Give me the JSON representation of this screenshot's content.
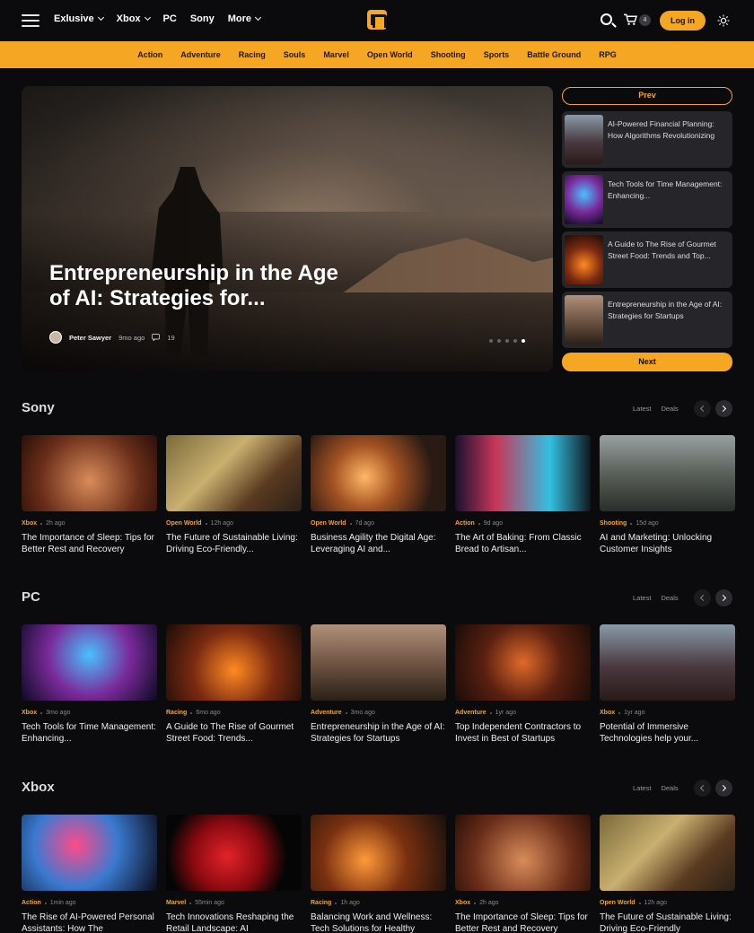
{
  "header": {
    "nav": [
      {
        "label": "Exlusive",
        "has_dropdown": true
      },
      {
        "label": "Xbox",
        "has_dropdown": true
      },
      {
        "label": "PC",
        "has_dropdown": false
      },
      {
        "label": "Sony",
        "has_dropdown": false
      },
      {
        "label": "More",
        "has_dropdown": true
      }
    ],
    "cart_count": "4",
    "login_label": "Log in"
  },
  "categories": [
    "Action",
    "Adventure",
    "Racing",
    "Souls",
    "Marvel",
    "Open World",
    "Shooting",
    "Sports",
    "Battle Ground",
    "RPG"
  ],
  "hero": {
    "title": "Entrepreneurship in the Age of AI: Strategies for...",
    "author": "Peter Sawyer",
    "time": "9mo ago",
    "comments": "19"
  },
  "side": {
    "prev_label": "Prev",
    "next_label": "Next",
    "items": [
      "AI-Powered Financial Planning: How Algorithms Revolutionizing",
      "Tech Tools for Time Management: Enhancing...",
      "A Guide to The Rise of Gourmet Street Food: Trends and Top...",
      "Entrepreneurship in the Age of AI: Strategies for Startups"
    ]
  },
  "sections": [
    {
      "title": "Sony",
      "tabs": [
        "Latest",
        "Deals"
      ],
      "cards": [
        {
          "category": "Xbox",
          "time": "2h ago",
          "title": "The Importance of Sleep: Tips for Better Rest and Recovery"
        },
        {
          "category": "Open World",
          "time": "12h ago",
          "title": "The Future of Sustainable Living: Driving Eco-Friendly..."
        },
        {
          "category": "Open World",
          "time": "7d ago",
          "title": "Business Agility the Digital Age: Leveraging AI and..."
        },
        {
          "category": "Action",
          "time": "9d ago",
          "title": "The Art of Baking: From Classic Bread to Artisan..."
        },
        {
          "category": "Shooting",
          "time": "15d ago",
          "title": "AI and Marketing: Unlocking Customer Insights"
        }
      ]
    },
    {
      "title": "PC",
      "tabs": [
        "Latest",
        "Deals"
      ],
      "cards": [
        {
          "category": "Xbox",
          "time": "3mo ago",
          "title": "Tech Tools for Time Management: Enhancing..."
        },
        {
          "category": "Racing",
          "time": "6mo ago",
          "title": "A Guide to The Rise of Gourmet Street Food: Trends..."
        },
        {
          "category": "Adventure",
          "time": "3mo ago",
          "title": "Entrepreneurship in the Age of AI: Strategies for Startups"
        },
        {
          "category": "Adventure",
          "time": "1yr ago",
          "title": "Top Independent Contractors to Invest in Best of Startups"
        },
        {
          "category": "Xbox",
          "time": "1yr ago",
          "title": "Potential of Immersive Technologies help your..."
        }
      ]
    },
    {
      "title": "Xbox",
      "tabs": [
        "Latest",
        "Deals"
      ],
      "cards": [
        {
          "category": "Action",
          "time": "1min ago",
          "title": "The Rise of AI-Powered Personal Assistants: How The"
        },
        {
          "category": "Marvel",
          "time": "55min ago",
          "title": "Tech Innovations Reshaping the Retail Landscape: AI"
        },
        {
          "category": "Racing",
          "time": "1h ago",
          "title": "Balancing Work and Wellness: Tech Solutions for Healthy"
        },
        {
          "category": "Xbox",
          "time": "2h ago",
          "title": "The Importance of Sleep: Tips for Better Rest and Recovery"
        },
        {
          "category": "Open World",
          "time": "12h ago",
          "title": "The Future of Sustainable Living: Driving Eco-Friendly"
        }
      ]
    }
  ],
  "colors": {
    "accent": "#f5a623",
    "background": "#0b0b0d",
    "card": "#26262a"
  }
}
